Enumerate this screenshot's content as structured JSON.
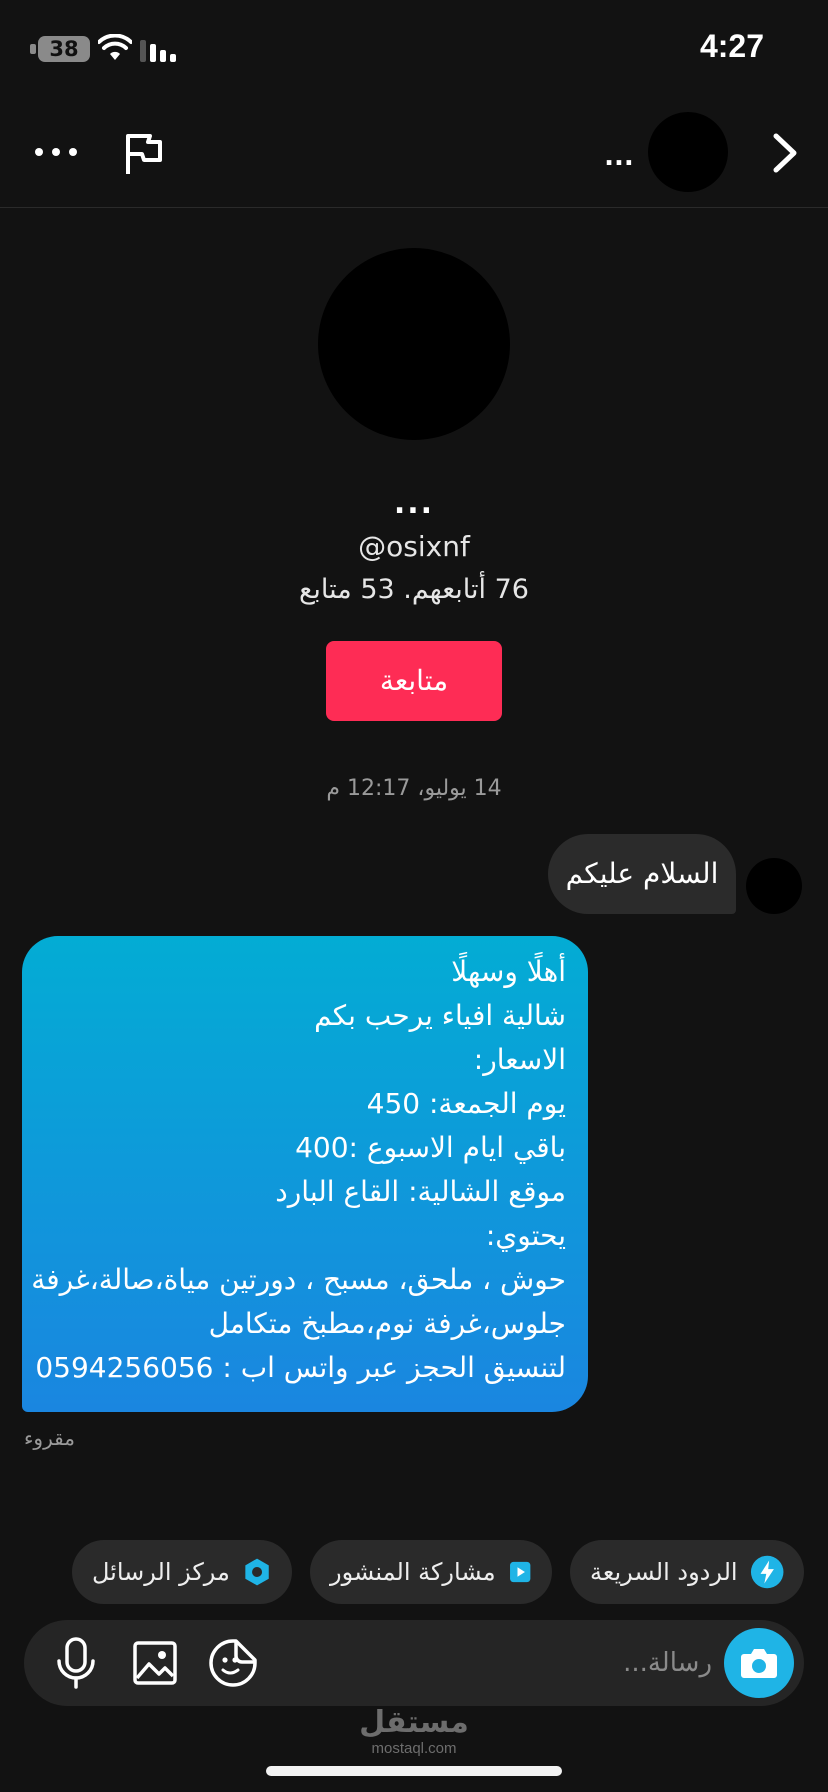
{
  "status_bar": {
    "time": "4:27",
    "battery": "38"
  },
  "header": {
    "name": "..."
  },
  "profile": {
    "name": "...",
    "handle": "@osixnf",
    "stats": "76 أتابعهم. 53 متابع",
    "follow_label": "متابعة"
  },
  "conversation": {
    "timestamp": "14 يوليو، 12:17 م",
    "incoming": {
      "text": "السلام عليكم"
    },
    "outgoing": {
      "lines": [
        "أهلًا وسهلًا",
        "شالية افياء يرحب بكم",
        "الاسعار:",
        "يوم الجمعة: 450",
        "باقي ايام الاسبوع :400",
        "موقع الشالية: القاع البارد",
        "يحتوي:",
        "حوش ، ملحق، مسبح ، دورتين مياة،صالة،غرفة",
        "جلوس،غرفة نوم،مطبخ متكامل",
        "لتنسيق الحجز عبر واتس اب : 0594256056"
      ]
    },
    "read_status": "مقروء"
  },
  "quick_actions": {
    "quick_replies": "الردود السريعة",
    "share_post": "مشاركة المنشور",
    "message_center": "مركز الرسائل"
  },
  "composer": {
    "placeholder": "رسالة..."
  },
  "watermark": {
    "arabic": "مستقل",
    "latin": "mostaql.com"
  },
  "colors": {
    "background": "#121212",
    "follow_button": "#fe2c55",
    "bubble_gradient_top": "#03acd4",
    "bubble_gradient_bottom": "#1a86e0",
    "camera_button": "#1fb4e6"
  }
}
